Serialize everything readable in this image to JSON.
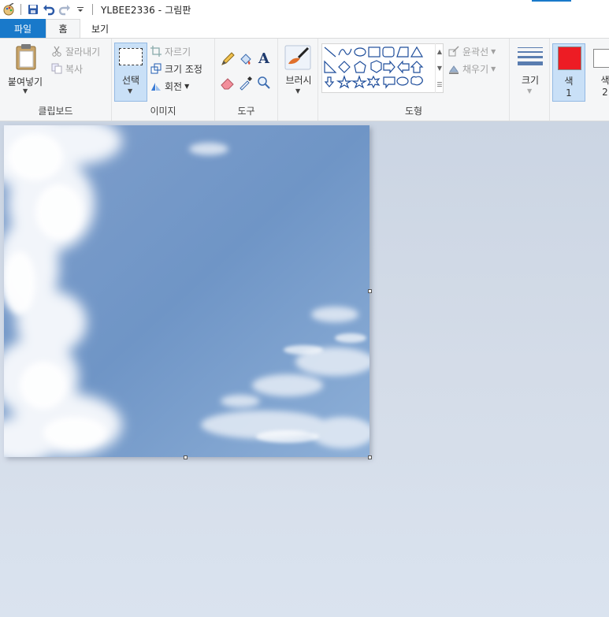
{
  "window": {
    "title": "YLBEE2336 - 그림판",
    "accent_color": "#1979ca"
  },
  "quick_access": {
    "icons": [
      "paint-app-icon",
      "save-icon",
      "undo-icon",
      "redo-icon",
      "customize-dropdown-icon"
    ]
  },
  "tabs": {
    "file": "파일",
    "home": "홈",
    "view": "보기"
  },
  "ribbon": {
    "clipboard": {
      "label": "클립보드",
      "paste": "붙여넣기",
      "cut": "잘라내기",
      "copy": "복사"
    },
    "image": {
      "label": "이미지",
      "select": "선택",
      "crop": "자르기",
      "resize": "크기 조정",
      "rotate": "회전"
    },
    "tools": {
      "label": "도구"
    },
    "brushes": {
      "label": "브러시"
    },
    "shapes": {
      "label": "도형",
      "outline": "윤곽선",
      "fill": "채우기"
    },
    "size": {
      "label": "크기"
    },
    "colors": {
      "color1_label": "색",
      "color1_num": "1",
      "color1_value": "#ed1c24",
      "color2_label": "색",
      "color2_num": "2",
      "color2_value": "#ffffff"
    }
  }
}
